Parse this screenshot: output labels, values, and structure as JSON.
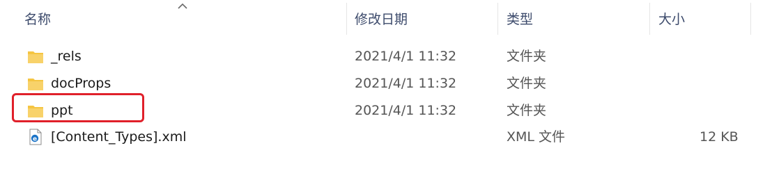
{
  "columns": {
    "name": "名称",
    "modified": "修改日期",
    "type": "类型",
    "size": "大小"
  },
  "sort": {
    "column": "name",
    "direction": "ascending",
    "icon": "chevron-up-icon"
  },
  "files": [
    {
      "name": "_rels",
      "modified": "2021/4/1 11:32",
      "type": "文件夹",
      "size": "",
      "icon": "folder-icon"
    },
    {
      "name": "docProps",
      "modified": "2021/4/1 11:32",
      "type": "文件夹",
      "size": "",
      "icon": "folder-icon"
    },
    {
      "name": "ppt",
      "modified": "2021/4/1 11:32",
      "type": "文件夹",
      "size": "",
      "icon": "folder-icon"
    },
    {
      "name": "[Content_Types].xml",
      "modified": "",
      "type": "XML 文件",
      "size": "12 KB",
      "icon": "xml-file-icon"
    }
  ],
  "highlight": {
    "target": "ppt",
    "color": "#e0202a"
  },
  "colors": {
    "header_text": "#3c4a6b",
    "folder": "#f5c542",
    "edge_blue": "#1a73c7"
  }
}
